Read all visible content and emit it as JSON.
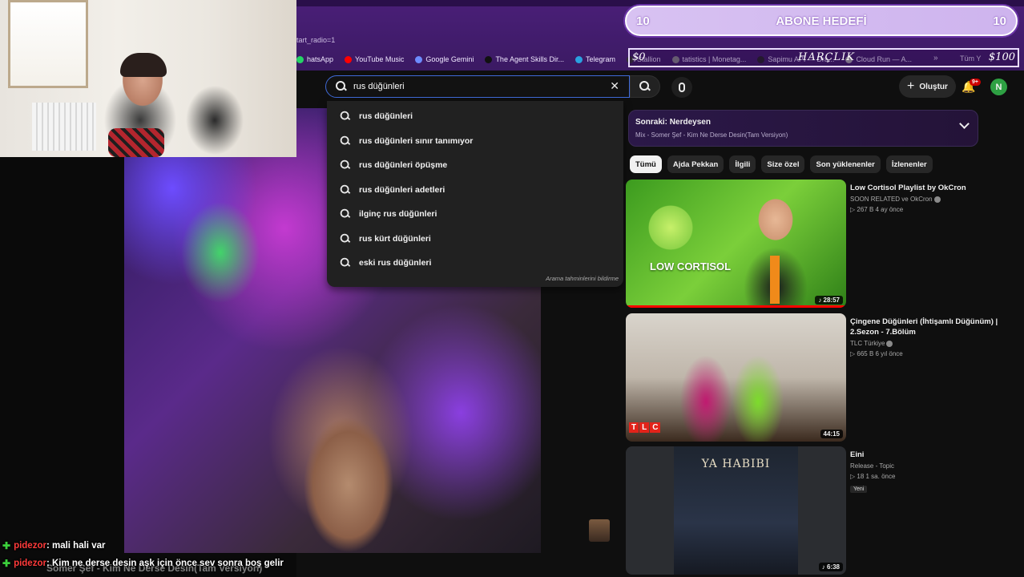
{
  "browser": {
    "url_fragment": "tart_radio=1",
    "bookmarks": [
      {
        "label": "hatsApp",
        "color": "#25d366"
      },
      {
        "label": "YouTube Music",
        "color": "#ff0000"
      },
      {
        "label": "Google Gemini",
        "color": "#6d8cff"
      },
      {
        "label": "The Agent Skills Dir...",
        "color": "#111111"
      },
      {
        "label": "Telegram",
        "color": "#2aa1e0"
      },
      {
        "label": "Stallion",
        "color": "#333333"
      },
      {
        "label": "tatistics | Monetag...",
        "color": "#888888"
      },
      {
        "label": "Sapimu API — Dra...",
        "color": "#222222"
      },
      {
        "label": "Cloud Run — A...",
        "color": "#aaaaaa"
      }
    ],
    "more": "»",
    "all_bookmarks": "Tüm Y"
  },
  "search": {
    "value": "rus düğünleri",
    "clear_icon": "close-icon"
  },
  "header": {
    "create_label": "Oluştur",
    "notif_count": "9+",
    "avatar_initial": "N"
  },
  "suggestions": {
    "items": [
      "rus düğünleri",
      "rus düğünleri sınır tanımıyor",
      "rus düğünleri öpüşme",
      "rus düğünleri adetleri",
      "ilginç rus düğünleri",
      "rus kürt düğünleri",
      "eski rus düğünleri"
    ],
    "report_label": "Arama tahminlerini bildirme"
  },
  "next": {
    "title": "Sonraki: Nerdeysen",
    "subtitle": "Mix - Somer Şef - Kim Ne Derse Desin(Tam Versiyon)"
  },
  "chips": [
    "Tümü",
    "Ajda Pekkan",
    "İlgili",
    "Size özel",
    "Son yüklenenler",
    "İzlenenler"
  ],
  "videos": [
    {
      "title": "Low Cortisol Playlist by OkCron",
      "channel": "SOON RELATED ve OkCron",
      "stats": "▷ 267 B  4 ay önce",
      "duration": "♪ 28:57",
      "thumb_text": "LOW CORTISOL"
    },
    {
      "title": "Çingene Düğünleri (İhtişamlı Düğünüm) | 2.Sezon - 7.Bölüm",
      "channel": "TLC Türkiye",
      "stats": "▷ 665 B  6 yıl önce",
      "duration": "44:15",
      "thumb_logo": [
        "T",
        "L",
        "C"
      ]
    },
    {
      "title": "Eini",
      "channel": "Release - Topic",
      "stats": "▷ 18  1 sa. önce",
      "badge": "Yeni",
      "duration": "♪ 6:38",
      "thumb_text": "YA HABIBI"
    }
  ],
  "overlay": {
    "goal_title": "ABONE HEDEFİ",
    "goal_left": "10",
    "goal_right": "10",
    "harclik_left": "$0",
    "harclik_center": "HARÇLIK",
    "harclik_right": "$100"
  },
  "chat": [
    {
      "user": "pidezor",
      "message": ": mali hali var"
    },
    {
      "user": "pidezor",
      "message": ": Kim ne derse desin aşk için önce sev sonra boş gelir"
    }
  ],
  "video_caption": "Somer Şef - Kim Ne Derse Desin(Tam Versiyon)"
}
